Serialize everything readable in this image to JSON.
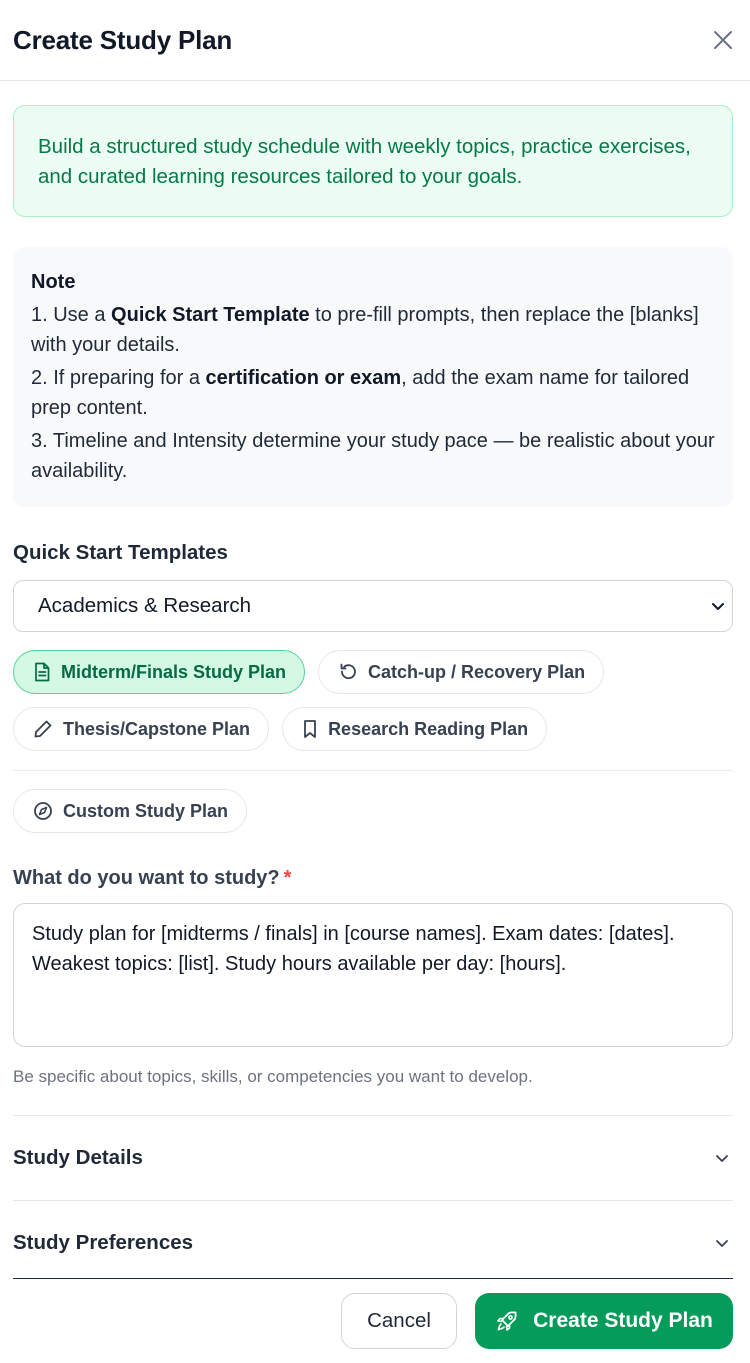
{
  "header": {
    "title": "Create Study Plan",
    "close_icon": "close-icon"
  },
  "info": {
    "text": "Build a structured study schedule with weekly topics, practice exercises, and curated learning resources tailored to your goals."
  },
  "note": {
    "title": "Note",
    "line1_pre": "1. Use a ",
    "line1_bold": "Quick Start Template",
    "line1_post": " to pre-fill prompts, then replace the [blanks] with your details.",
    "line2_pre": "2. If preparing for a ",
    "line2_bold": "certification or exam",
    "line2_post": ", add the exam name for tailored prep content.",
    "line3": "3. Timeline and Intensity determine your study pace — be realistic about your availability."
  },
  "templates": {
    "label": "Quick Start Templates",
    "selected_category": "Academics & Research",
    "chips": [
      {
        "label": "Midterm/Finals Study Plan",
        "icon": "document-icon",
        "active": true
      },
      {
        "label": "Catch-up / Recovery Plan",
        "icon": "rotate-ccw-icon",
        "active": false
      },
      {
        "label": "Thesis/Capstone Plan",
        "icon": "pencil-icon",
        "active": false
      },
      {
        "label": "Research Reading Plan",
        "icon": "bookmark-icon",
        "active": false
      }
    ],
    "custom_label": "Custom Study Plan",
    "custom_icon": "compass-icon"
  },
  "study_input": {
    "label": "What do you want to study?",
    "required_mark": "*",
    "value": "Study plan for [midterms / finals] in [course names]. Exam dates: [dates]. Weakest topics: [list]. Study hours available per day: [hours].",
    "helper": "Be specific about topics, skills, or competencies you want to develop."
  },
  "sections": {
    "details": "Study Details",
    "preferences": "Study Preferences"
  },
  "footer": {
    "cancel": "Cancel",
    "submit": "Create Study Plan",
    "submit_icon": "rocket-icon"
  },
  "colors": {
    "accent": "#059c5b",
    "info_bg": "#ecfdf3",
    "info_text": "#047a47",
    "chip_active_bg": "#d3f8e4",
    "required": "#ef4444"
  }
}
